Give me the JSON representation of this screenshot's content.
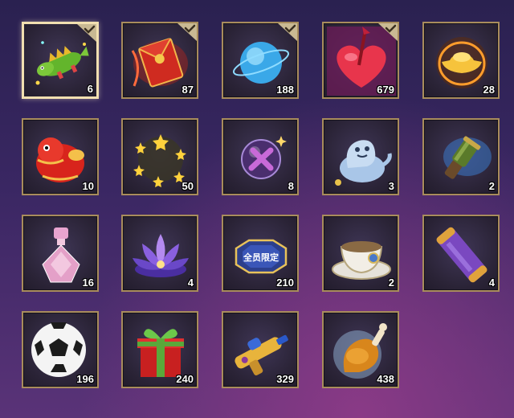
{
  "inventory": {
    "items": [
      {
        "id": "dragon-toy",
        "icon": "dragon-toy-icon",
        "count": "6",
        "owned": true,
        "selected": true
      },
      {
        "id": "red-envelope",
        "icon": "red-envelope-icon",
        "count": "87",
        "owned": true,
        "selected": false
      },
      {
        "id": "blue-orb",
        "icon": "blue-orb-icon",
        "count": "188",
        "owned": true,
        "selected": false
      },
      {
        "id": "heart-arrow",
        "icon": "heart-arrow-icon",
        "count": "679",
        "owned": true,
        "selected": false
      },
      {
        "id": "gold-ingot",
        "icon": "gold-ingot-icon",
        "count": "28",
        "owned": false,
        "selected": false
      },
      {
        "id": "lion-dance",
        "icon": "lion-dance-icon",
        "count": "10",
        "owned": false,
        "selected": false
      },
      {
        "id": "star-ring",
        "icon": "star-ring-icon",
        "count": "50",
        "owned": false,
        "selected": false
      },
      {
        "id": "cross-bubble",
        "icon": "cross-bubble-icon",
        "count": "8",
        "owned": false,
        "selected": false
      },
      {
        "id": "ghost-teapot",
        "icon": "ghost-teapot-icon",
        "count": "3",
        "owned": false,
        "selected": false
      },
      {
        "id": "telescope",
        "icon": "telescope-icon",
        "count": "2",
        "owned": false,
        "selected": false
      },
      {
        "id": "perfume-bottle",
        "icon": "perfume-bottle-icon",
        "count": "16",
        "owned": false,
        "selected": false
      },
      {
        "id": "lotus",
        "icon": "lotus-icon",
        "count": "4",
        "owned": false,
        "selected": false
      },
      {
        "id": "badge",
        "icon": "limited-badge-icon",
        "count": "210",
        "owned": false,
        "selected": false,
        "badge_text": "全员限定"
      },
      {
        "id": "teacup",
        "icon": "teacup-icon",
        "count": "2",
        "owned": false,
        "selected": false
      },
      {
        "id": "scroll",
        "icon": "scroll-icon",
        "count": "4",
        "owned": false,
        "selected": false
      },
      {
        "id": "soccer-ball",
        "icon": "soccer-ball-icon",
        "count": "196",
        "owned": false,
        "selected": false
      },
      {
        "id": "gift-box",
        "icon": "gift-box-icon",
        "count": "240",
        "owned": false,
        "selected": false
      },
      {
        "id": "water-gun",
        "icon": "water-gun-icon",
        "count": "329",
        "owned": false,
        "selected": false
      },
      {
        "id": "chicken-leg",
        "icon": "chicken-leg-icon",
        "count": "438",
        "owned": false,
        "selected": false
      }
    ]
  },
  "colors": {
    "frame": "#a88c5c",
    "frame_selected": "#f1dfb0",
    "check_tag": "#c9b993"
  }
}
